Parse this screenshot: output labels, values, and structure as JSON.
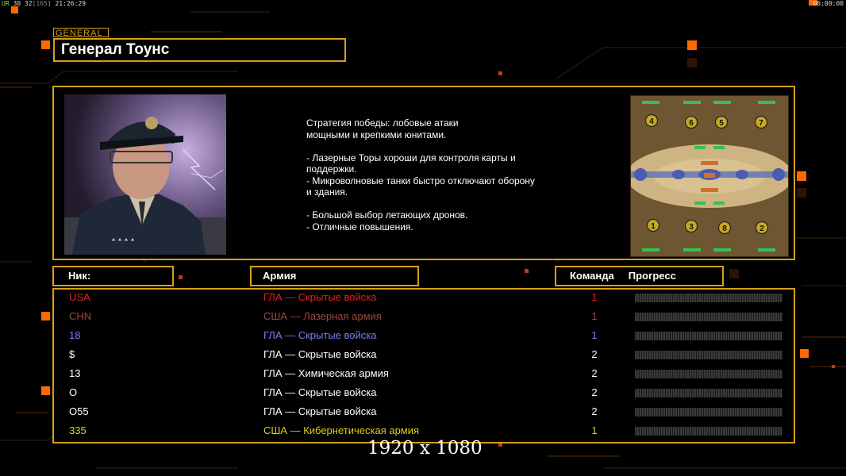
{
  "hud": {
    "left_prefix": "UR",
    "left_fps": "30 32",
    "left_bracket": "[165]",
    "left_time": "21:26:29",
    "right_time": "00:00:00"
  },
  "general": {
    "tag": "GENERAL",
    "name": "Генерал Тоунс"
  },
  "strategy_text": "Стратегия победы: лобовые атаки\nмощными и крепкими юнитами.\n\n- Лазерные Торы хороши для контроля карты и\n поддержки.\n- Микроволновые танки быстро отключают оборону\n и здания.\n\n- Большой выбор летающих дронов.\n- Отличные повышения.",
  "minimap": {
    "slots_top": [
      "4",
      "6",
      "5",
      "7"
    ],
    "slots_bottom": [
      "1",
      "3",
      "8",
      "2"
    ]
  },
  "headers": {
    "nick": "Ник:",
    "army": "Армия",
    "team": "Команда",
    "progress": "Прогресс"
  },
  "players": [
    {
      "nick": "USA",
      "army": "ГЛА — Скрытые войска",
      "team": "1",
      "color": "#e02020",
      "progress": 0
    },
    {
      "nick": "CHN",
      "army": "США — Лазерная армия",
      "team": "1",
      "color": "#9a4a3c",
      "progress": 0
    },
    {
      "nick": "18",
      "army": "ГЛА — Скрытые войска",
      "team": "1",
      "color": "#7a7ff0",
      "progress": 0
    },
    {
      "nick": "$",
      "army": "ГЛА — Скрытые войска",
      "team": "2",
      "color": "#ffffff",
      "progress": 0
    },
    {
      "nick": "13",
      "army": "ГЛА — Химическая армия",
      "team": "2",
      "color": "#ffffff",
      "progress": 0
    },
    {
      "nick": "O",
      "army": "ГЛА — Скрытые войска",
      "team": "2",
      "color": "#ffffff",
      "progress": 0
    },
    {
      "nick": "O55",
      "army": "ГЛА — Скрытые войска",
      "team": "2",
      "color": "#ffffff",
      "progress": 0
    },
    {
      "nick": "335",
      "army": "США — Кибернетическая армия",
      "team": "1",
      "color": "#d8d020",
      "progress": 0
    }
  ],
  "resolution_label": "1920 x 1080",
  "colors": {
    "accent": "#d4a017",
    "background": "#000000",
    "orange_glow": "#ff6a00"
  }
}
